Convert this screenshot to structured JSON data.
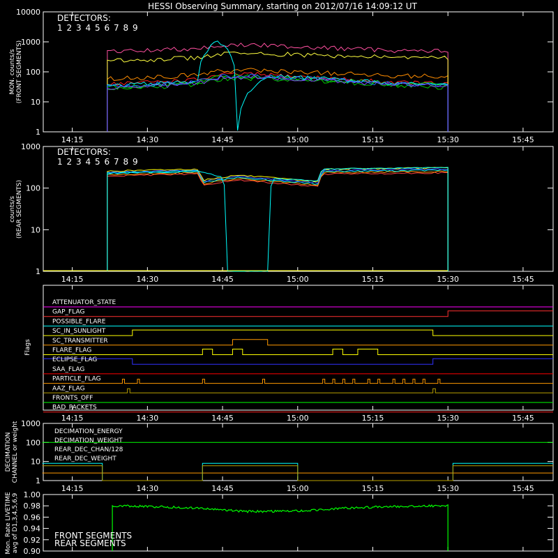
{
  "title": "HESSI Observing Summary, starting on 2012/07/16 14:09:12 UT",
  "colors": {
    "white": "#ffffff",
    "detectors": [
      "#ff2020",
      "#ff50a0",
      "#ff8c00",
      "#ffff40",
      "#00c800",
      "#00e000",
      "#00ffff",
      "#1f6fff",
      "#8040ff"
    ],
    "front_band": [
      "#ff3399",
      "#ffff33",
      "#cc9900",
      "#00ffff",
      "#3333ff",
      "#00cc00"
    ],
    "rear_band": [
      "#ff4040",
      "#ff9900",
      "#00ffff",
      "#4040ff",
      "#ffff00"
    ],
    "cyan": "#00ffff",
    "green": "#00ff00",
    "orange": "#ff9900",
    "yellow": "#ffff00"
  },
  "panels": {
    "front": {
      "ylabel1": "MON. counts/s",
      "ylabel2": "(FRONT SEGMENTS)",
      "detectors_label": "DETECTORS:",
      "detector_numbers": [
        "1",
        "2",
        "3",
        "4",
        "5",
        "6",
        "7",
        "8",
        "9"
      ],
      "ytick_labels": [
        "1",
        "10",
        "100",
        "1000",
        "10000"
      ]
    },
    "rear": {
      "ylabel1": "counts/s",
      "ylabel2": "(REAR SEGMENTS)",
      "detectors_label": "DETECTORS:",
      "detector_numbers": [
        "1",
        "2",
        "3",
        "4",
        "5",
        "6",
        "7",
        "8",
        "9"
      ],
      "ytick_labels": [
        "1",
        "10",
        "100",
        "1000"
      ]
    },
    "flags": {
      "ylabel": "Flags",
      "items": [
        {
          "name": "ATTENUATOR_STATE",
          "color": "#ff00ff"
        },
        {
          "name": "GAP_FLAG",
          "color": "#ff3030"
        },
        {
          "name": "POSSIBLE_FLARE",
          "color": "#00ffff"
        },
        {
          "name": "SC_IN_SUNLIGHT",
          "color": "#ffff00"
        },
        {
          "name": "SC_TRANSMITTER",
          "color": "#ff9900"
        },
        {
          "name": "FLARE_FLAG",
          "color": "#ffff00"
        },
        {
          "name": "ECLIPSE_FLAG",
          "color": "#3030ff"
        },
        {
          "name": "SAA_FLAG",
          "color": "#ff0000"
        },
        {
          "name": "PARTICLE_FLAG",
          "color": "#ff9900"
        },
        {
          "name": "AAZ_FLAG",
          "color": "#b8a000"
        },
        {
          "name": "FRONTS_OFF",
          "color": "#00ff00"
        },
        {
          "name": "BAD_PACKETS",
          "color": "#ff2020"
        }
      ]
    },
    "decimation": {
      "ylabel1": "DECIMATION",
      "ylabel2": "CHANNEL or weight",
      "ytick_labels": [
        "1",
        "10",
        "100",
        "1000"
      ],
      "legend": [
        {
          "name": "DECIMATION_ENERGY",
          "color": "#00ff00"
        },
        {
          "name": "DECIMATION_WEIGHT",
          "color": "#ff9900"
        },
        {
          "name": "REAR_DEC_CHAN/128",
          "color": "#00ffff"
        },
        {
          "name": "REAR_DEC_WEIGHT",
          "color": "#b8a000"
        }
      ]
    },
    "livetime": {
      "ylabel1": "Mon. Rate LIVETIME",
      "ylabel2": "avg of D1,3,4,5,6,9",
      "ytick_labels": [
        "0.90",
        "0.92",
        "0.94",
        "0.96",
        "0.98",
        "1.00"
      ],
      "legend": [
        {
          "name": "FRONT SEGMENTS",
          "color": "#00ff00"
        },
        {
          "name": "REAR SEGMENTS",
          "color": "#00a000"
        }
      ]
    }
  },
  "xtick_labels": [
    "14:15",
    "14:30",
    "14:45",
    "15:00",
    "15:15",
    "15:30",
    "15:45"
  ],
  "chart_data": [
    {
      "type": "line",
      "panel": "front",
      "xlim": [
        "14:09:12",
        "15:51:00"
      ],
      "ylim": [
        1,
        10000
      ],
      "yscale": "log",
      "x_start": "14:22:00",
      "x_end": "15:30:00",
      "series": [
        {
          "name": "1",
          "x": [
            "14:22",
            "14:30",
            "14:40",
            "14:45",
            "14:50",
            "15:00",
            "15:10",
            "15:20",
            "15:30"
          ],
          "values": [
            40,
            45,
            55,
            80,
            85,
            70,
            55,
            45,
            40
          ]
        },
        {
          "name": "2",
          "x": [
            "14:22",
            "14:30",
            "14:40",
            "14:45",
            "14:50",
            "15:00",
            "15:10",
            "15:20",
            "15:30"
          ],
          "values": [
            480,
            520,
            620,
            760,
            800,
            700,
            590,
            520,
            500
          ]
        },
        {
          "name": "3",
          "x": [
            "14:22",
            "14:30",
            "14:40",
            "14:45",
            "14:50",
            "15:00",
            "15:10",
            "15:20",
            "15:30"
          ],
          "values": [
            60,
            65,
            80,
            110,
            115,
            100,
            85,
            75,
            70
          ]
        },
        {
          "name": "4",
          "x": [
            "14:22",
            "14:30",
            "14:40",
            "14:45",
            "14:50",
            "15:00",
            "15:10",
            "15:20",
            "15:30"
          ],
          "values": [
            240,
            255,
            300,
            400,
            410,
            380,
            330,
            300,
            300
          ]
        },
        {
          "name": "5",
          "x": [
            "14:22",
            "14:30",
            "14:40",
            "14:45",
            "14:50",
            "15:00",
            "15:10",
            "15:20",
            "15:30"
          ],
          "values": [
            25,
            30,
            38,
            60,
            62,
            55,
            45,
            35,
            30
          ]
        },
        {
          "name": "6",
          "x": [
            "14:22",
            "14:30",
            "14:40",
            "14:45",
            "14:50",
            "15:00",
            "15:10",
            "15:20",
            "15:30"
          ],
          "values": [
            30,
            35,
            45,
            70,
            72,
            60,
            50,
            40,
            35
          ]
        },
        {
          "name": "7",
          "x": [
            "14:22",
            "14:30",
            "14:40",
            "14:44",
            "14:48",
            "14:56",
            "15:00",
            "15:10",
            "15:20",
            "15:30"
          ],
          "values": [
            35,
            40,
            50,
            1000,
            1,
            75,
            65,
            52,
            42,
            38
          ]
        },
        {
          "name": "8",
          "x": [
            "14:22",
            "14:30",
            "14:40",
            "14:45",
            "14:50",
            "15:00",
            "15:10",
            "15:20",
            "15:30"
          ],
          "values": [
            32,
            38,
            48,
            72,
            75,
            62,
            50,
            40,
            35
          ]
        },
        {
          "name": "9",
          "x": [
            "14:22",
            "14:30",
            "14:40",
            "14:45",
            "14:50",
            "15:00",
            "15:10",
            "15:20",
            "15:30"
          ],
          "values": [
            28,
            33,
            42,
            66,
            68,
            58,
            48,
            38,
            32
          ]
        }
      ]
    },
    {
      "type": "line",
      "panel": "rear",
      "xlim": [
        "14:09:12",
        "15:51:00"
      ],
      "ylim": [
        1,
        1000
      ],
      "yscale": "log",
      "series": [
        {
          "name": "1-6,8,9",
          "x": [
            "14:22",
            "14:40",
            "14:41",
            "14:48",
            "14:58",
            "15:04",
            "15:05",
            "15:30"
          ],
          "values": [
            250,
            280,
            150,
            200,
            160,
            140,
            280,
            300
          ]
        },
        {
          "name": "7",
          "x": [
            "14:22",
            "14:40",
            "14:45",
            "14:46",
            "14:54",
            "14:55",
            "15:04",
            "15:05",
            "15:30"
          ],
          "values": [
            230,
            260,
            180,
            1,
            1,
            170,
            150,
            290,
            310
          ]
        }
      ]
    },
    {
      "type": "line",
      "panel": "flags",
      "xlim": [
        "14:09:12",
        "15:51:00"
      ],
      "series": [
        {
          "name": "GAP_FLAG",
          "x": [
            "14:09",
            "15:30",
            "15:51"
          ],
          "values": [
            0,
            1,
            1
          ]
        },
        {
          "name": "SC_IN_SUNLIGHT",
          "x": [
            "14:09",
            "14:27",
            "15:27",
            "15:51"
          ],
          "values": [
            0,
            1,
            0,
            0
          ]
        },
        {
          "name": "SC_TRANSMITTER",
          "x": [
            "14:09",
            "14:47",
            "14:54",
            "15:51"
          ],
          "values": [
            0,
            1,
            0,
            0
          ]
        },
        {
          "name": "FLARE_FLAG",
          "x": [
            "14:09",
            "14:41",
            "14:43",
            "14:47",
            "14:49",
            "15:07",
            "15:09",
            "15:12",
            "15:16",
            "15:51"
          ],
          "values": [
            0,
            1,
            0,
            1,
            0,
            1,
            0,
            1,
            0,
            0
          ]
        },
        {
          "name": "ECLIPSE_FLAG",
          "x": [
            "14:09",
            "14:27",
            "15:27",
            "15:51"
          ],
          "values": [
            1,
            0,
            1,
            1
          ]
        }
      ]
    },
    {
      "type": "line",
      "panel": "decimation",
      "xlim": [
        "14:09:12",
        "15:51:00"
      ],
      "ylim": [
        1,
        1000
      ],
      "yscale": "log",
      "series": [
        {
          "name": "DECIMATION_ENERGY",
          "x": [
            "14:09",
            "15:51"
          ],
          "values": [
            100,
            100
          ]
        },
        {
          "name": "DECIMATION_WEIGHT",
          "x": [
            "14:09",
            "15:51"
          ],
          "values": [
            2.5,
            2.5
          ]
        },
        {
          "name": "REAR_DEC_CHAN/128",
          "x": [
            "14:09",
            "14:21",
            "14:21",
            "14:41",
            "14:41",
            "15:00",
            "15:00",
            "15:31",
            "15:31",
            "15:51"
          ],
          "values": [
            8,
            8,
            1,
            1,
            8,
            8,
            1,
            1,
            8,
            8
          ]
        },
        {
          "name": "REAR_DEC_WEIGHT",
          "x": [
            "14:09",
            "14:21",
            "14:21",
            "14:41",
            "14:41",
            "15:00",
            "15:00",
            "15:31",
            "15:31",
            "15:51"
          ],
          "values": [
            6,
            6,
            1,
            1,
            6,
            6,
            1,
            1,
            6,
            6
          ]
        }
      ]
    },
    {
      "type": "line",
      "panel": "livetime",
      "xlim": [
        "14:09:12",
        "15:51:00"
      ],
      "ylim": [
        0.9,
        1.0
      ],
      "series": [
        {
          "name": "FRONT SEGMENTS",
          "x": [
            "14:23",
            "14:30",
            "14:40",
            "14:50",
            "15:00",
            "15:10",
            "15:20",
            "15:30"
          ],
          "values": [
            0.98,
            0.979,
            0.976,
            0.97,
            0.971,
            0.976,
            0.979,
            0.98
          ]
        }
      ]
    }
  ]
}
